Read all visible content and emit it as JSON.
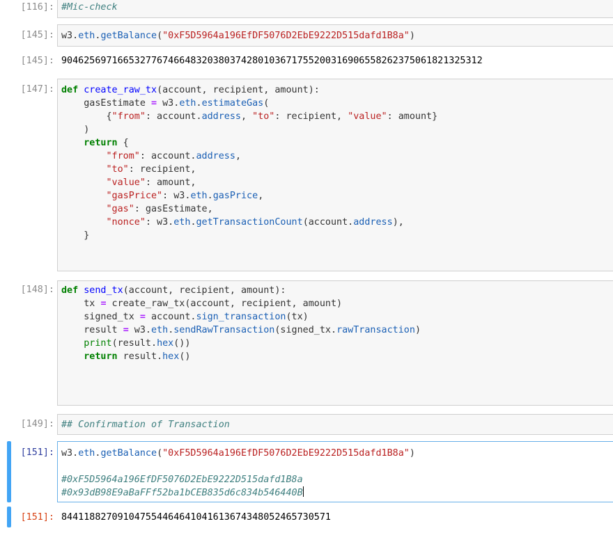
{
  "cells": {
    "c116": {
      "prompt": "[116]:",
      "text": "#Mic-check"
    },
    "c145": {
      "prompt": "[145]:",
      "code": {
        "a": "w3.",
        "b": "eth",
        "c": ".",
        "d": "getBalance",
        "e": "(",
        "f": "\"0xF5D5964a196EfDF5076D2EbE9222D515dafd1B8a\"",
        "g": ")"
      },
      "out_prompt": "[145]:",
      "output": "904625697166532776746648320380374280103671755200316906558262375061821325312"
    },
    "c147": {
      "prompt": "[147]:",
      "lines": [
        "def create_raw_tx(account, recipient, amount):",
        "    gasEstimate = w3.eth.estimateGas(",
        "        {\"from\": account.address, \"to\": recipient, \"value\": amount}",
        "    )",
        "    return {",
        "        \"from\": account.address,",
        "        \"to\": recipient,",
        "        \"value\": amount,",
        "        \"gasPrice\": w3.eth.gasPrice,",
        "        \"gas\": gasEstimate,",
        "        \"nonce\": w3.eth.getTransactionCount(account.address),",
        "    }"
      ]
    },
    "c148": {
      "prompt": "[148]:",
      "lines": [
        "def send_tx(account, recipient, amount):",
        "    tx = create_raw_tx(account, recipient, amount)",
        "    signed_tx = account.sign_transaction(tx)",
        "    result = w3.eth.sendRawTransaction(signed_tx.rawTransaction)",
        "    print(result.hex())",
        "    return result.hex()"
      ]
    },
    "c149": {
      "prompt": "[149]:",
      "text": "## Confirmation of Transaction"
    },
    "c151": {
      "prompt": "[151]:",
      "code_line": "w3.eth.getBalance(\"0xF5D5964a196EfDF5076D2EbE9222D515dafd1B8a\")",
      "comment1": "#0xF5D5964a196EfDF5076D2EbE9222D515dafd1B8a",
      "comment2": "#0x93dB98E9aBaFFf52ba1bCEB835d6c834b546440B",
      "out_prompt": "[151]:",
      "output": "844118827091047554464641041613674348052465730571"
    }
  },
  "colors": {
    "keyword": "#008000",
    "function": "#0000ff",
    "string": "#ba2121",
    "comment": "#408080",
    "selected_border": "#66afe9",
    "sidebar": "#42a5f5",
    "output_prompt": "#d84315"
  }
}
